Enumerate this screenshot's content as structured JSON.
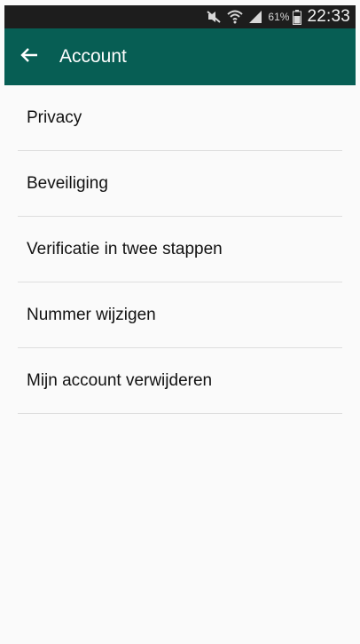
{
  "status_bar": {
    "icons": [
      "mute-icon",
      "wifi-icon",
      "signal-icon",
      "battery-icon"
    ],
    "battery_percent": "61%",
    "time": "22:33"
  },
  "app_bar": {
    "back_icon": "arrow-left-icon",
    "title": "Account",
    "color": "#075e54"
  },
  "menu": {
    "items": [
      {
        "label": "Privacy"
      },
      {
        "label": "Beveiliging"
      },
      {
        "label": "Verificatie in twee stappen"
      },
      {
        "label": "Nummer wijzigen"
      },
      {
        "label": "Mijn account verwijderen"
      }
    ]
  }
}
